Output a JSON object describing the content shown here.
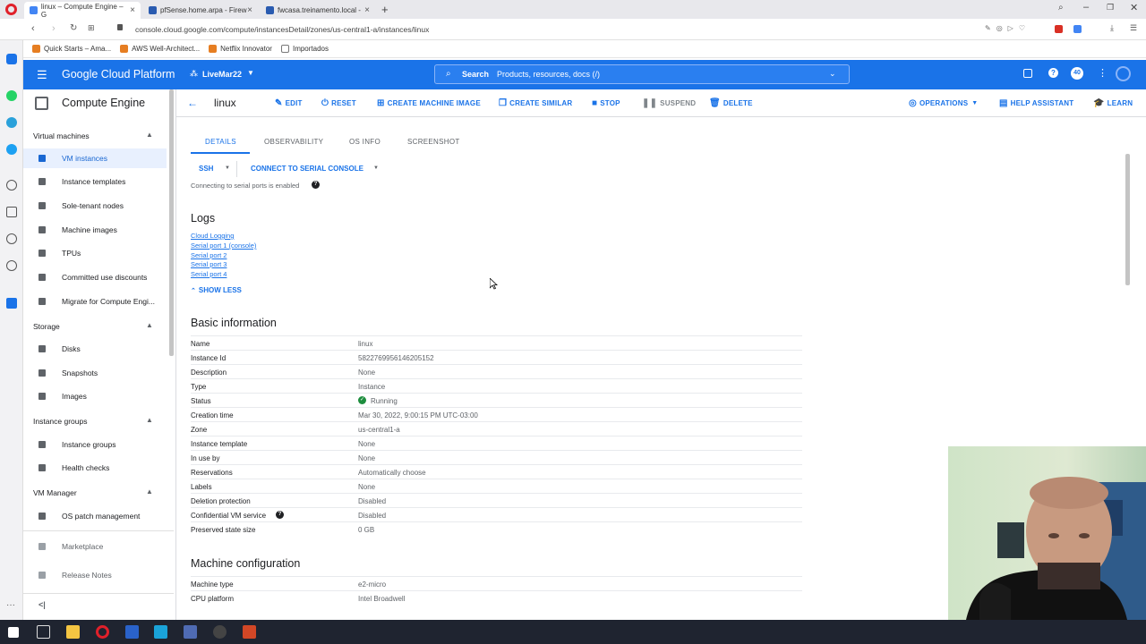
{
  "browser": {
    "tabs": [
      {
        "title": "linux – Compute Engine – G"
      },
      {
        "title": "pfSense.home.arpa - Firew"
      },
      {
        "title": "fwcasa.treinamento.local - "
      }
    ],
    "url": "console.cloud.google.com/compute/instancesDetail/zones/us-central1-a/instances/linux",
    "bookmarks": [
      "Quick Starts – Ama...",
      "AWS Well-Architect...",
      "Netflix Innovator",
      "Importados"
    ]
  },
  "gcp": {
    "product_name": "Google Cloud Platform",
    "project": "LiveMar22",
    "search_label": "Search",
    "search_placeholder": "Products, resources, docs (/)",
    "badge_count": "40"
  },
  "sidebar": {
    "title": "Compute Engine",
    "sections": [
      {
        "label": "Virtual machines"
      },
      {
        "label": "Storage"
      },
      {
        "label": "Instance groups"
      },
      {
        "label": "VM Manager"
      }
    ],
    "items": [
      {
        "label": "VM instances",
        "icon": "vm-icon"
      },
      {
        "label": "Instance templates",
        "icon": "template-icon"
      },
      {
        "label": "Sole-tenant nodes",
        "icon": "node-icon"
      },
      {
        "label": "Machine images",
        "icon": "image-icon"
      },
      {
        "label": "TPUs",
        "icon": "tpu-icon"
      },
      {
        "label": "Committed use discounts",
        "icon": "discount-icon"
      },
      {
        "label": "Migrate for Compute Engi...",
        "icon": "migrate-icon"
      },
      {
        "label": "Disks",
        "icon": "disk-icon"
      },
      {
        "label": "Snapshots",
        "icon": "snapshot-icon"
      },
      {
        "label": "Images",
        "icon": "images-icon"
      },
      {
        "label": "Instance groups",
        "icon": "groups-icon"
      },
      {
        "label": "Health checks",
        "icon": "health-icon"
      },
      {
        "label": "OS patch management",
        "icon": "patch-icon"
      },
      {
        "label": "Marketplace",
        "icon": "marketplace-icon"
      },
      {
        "label": "Release Notes",
        "icon": "notes-icon"
      }
    ],
    "collapse": "<|"
  },
  "toolbar": {
    "instance_name": "linux",
    "actions": {
      "edit": "EDIT",
      "reset": "RESET",
      "create_machine_image": "CREATE MACHINE IMAGE",
      "create_similar": "CREATE SIMILAR",
      "stop": "STOP",
      "suspend": "SUSPEND",
      "delete": "DELETE",
      "operations": "OPERATIONS",
      "help_assistant": "HELP ASSISTANT",
      "learn": "LEARN"
    }
  },
  "details": {
    "tabs": [
      "DETAILS",
      "OBSERVABILITY",
      "OS INFO",
      "SCREENSHOT"
    ],
    "ssh": "SSH",
    "serial_console": "CONNECT TO SERIAL CONSOLE",
    "serial_note": "Connecting to serial ports is enabled",
    "logs_title": "Logs",
    "logs": [
      "Cloud Logging",
      "Serial port 1 (console)",
      "Serial port 2",
      "Serial port 3",
      "Serial port 4"
    ],
    "show_less": "SHOW LESS",
    "basic_title": "Basic information",
    "basic": [
      {
        "k": "Name",
        "v": "linux"
      },
      {
        "k": "Instance Id",
        "v": "5822769956146205152"
      },
      {
        "k": "Description",
        "v": "None"
      },
      {
        "k": "Type",
        "v": "Instance"
      },
      {
        "k": "Status",
        "v": "Running"
      },
      {
        "k": "Creation time",
        "v": "Mar 30, 2022, 9:00:15 PM UTC-03:00"
      },
      {
        "k": "Zone",
        "v": "us-central1-a"
      },
      {
        "k": "Instance template",
        "v": "None"
      },
      {
        "k": "In use by",
        "v": "None"
      },
      {
        "k": "Reservations",
        "v": "Automatically choose"
      },
      {
        "k": "Labels",
        "v": "None"
      },
      {
        "k": "Deletion protection",
        "v": "Disabled"
      },
      {
        "k": "Confidential VM service",
        "v": "Disabled"
      },
      {
        "k": "Preserved state size",
        "v": "0 GB"
      }
    ],
    "machine_title": "Machine configuration",
    "machine": [
      {
        "k": "Machine type",
        "v": "e2-micro"
      },
      {
        "k": "CPU platform",
        "v": "Intel Broadwell"
      }
    ]
  },
  "colors": {
    "gcp_blue": "#1a73e8",
    "running_green": "#1e8e3e"
  }
}
